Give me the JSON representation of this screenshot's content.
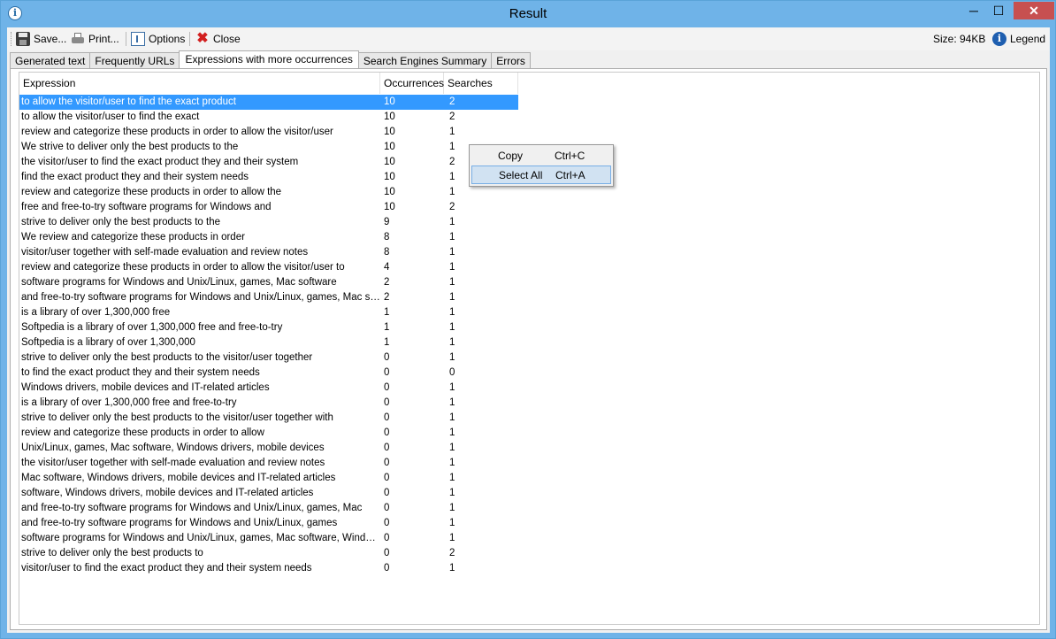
{
  "window": {
    "title": "Result",
    "minimize": "─",
    "maximize": "☐",
    "close": "✕"
  },
  "toolbar": {
    "save_label": "Save...",
    "print_label": "Print...",
    "options_label": "Options",
    "close_label": "Close",
    "size_label": "Size: 94KB",
    "legend_label": "Legend"
  },
  "tabs": [
    {
      "label": "Generated text",
      "active": false
    },
    {
      "label": "Frequently URLs",
      "active": false
    },
    {
      "label": "Expressions with more occurrences",
      "active": true
    },
    {
      "label": "Search Engines Summary",
      "active": false
    },
    {
      "label": "Errors",
      "active": false
    }
  ],
  "table": {
    "headers": [
      "Expression",
      "Occurrences",
      "Searches"
    ],
    "selected_row": 0,
    "rows": [
      [
        "to allow the visitor/user to find the exact product",
        "10",
        "2"
      ],
      [
        "to allow the visitor/user to find the exact",
        "10",
        "2"
      ],
      [
        "review and categorize these products in order to allow the visitor/user",
        "10",
        "1"
      ],
      [
        "We strive to deliver only the best products to the",
        "10",
        "1"
      ],
      [
        "the visitor/user to find the exact product they and their system",
        "10",
        "2"
      ],
      [
        "find the exact product they and their system needs",
        "10",
        "1"
      ],
      [
        "review and categorize these products in order to allow the",
        "10",
        "1"
      ],
      [
        "free and free-to-try software programs for Windows and",
        "10",
        "2"
      ],
      [
        "strive to deliver only the best products to the",
        "9",
        "1"
      ],
      [
        "We review and categorize these products in order",
        "8",
        "1"
      ],
      [
        "visitor/user together with self-made evaluation and review notes",
        "8",
        "1"
      ],
      [
        "review and categorize these products in order to allow the visitor/user to",
        "4",
        "1"
      ],
      [
        "software programs for Windows and Unix/Linux, games, Mac software",
        "2",
        "1"
      ],
      [
        "and free-to-try software programs for Windows and Unix/Linux, games, Mac software",
        "2",
        "1"
      ],
      [
        "is a library of over 1,300,000 free",
        "1",
        "1"
      ],
      [
        "Softpedia is a library of over 1,300,000 free and free-to-try",
        "1",
        "1"
      ],
      [
        "Softpedia is a library of over 1,300,000",
        "1",
        "1"
      ],
      [
        "strive to deliver only the best products to the visitor/user together",
        "0",
        "1"
      ],
      [
        "to find the exact product they and their system needs",
        "0",
        "0"
      ],
      [
        "Windows drivers, mobile devices and IT-related articles",
        "0",
        "1"
      ],
      [
        "is a library of over 1,300,000 free and free-to-try",
        "0",
        "1"
      ],
      [
        "strive to deliver only the best products to the visitor/user together with",
        "0",
        "1"
      ],
      [
        "review and categorize these products in order to allow",
        "0",
        "1"
      ],
      [
        "Unix/Linux, games, Mac software, Windows drivers, mobile devices",
        "0",
        "1"
      ],
      [
        "the visitor/user together with self-made evaluation and review notes",
        "0",
        "1"
      ],
      [
        "Mac software, Windows drivers, mobile devices and IT-related articles",
        "0",
        "1"
      ],
      [
        "software, Windows drivers, mobile devices and IT-related articles",
        "0",
        "1"
      ],
      [
        "and free-to-try software programs for Windows and Unix/Linux, games, Mac",
        "0",
        "1"
      ],
      [
        "and free-to-try software programs for Windows and Unix/Linux, games",
        "0",
        "1"
      ],
      [
        "software programs for Windows and Unix/Linux, games, Mac software, Windows dri...",
        "0",
        "1"
      ],
      [
        "strive to deliver only the best products to",
        "0",
        "2"
      ],
      [
        "visitor/user to find the exact product they and their system needs",
        "0",
        "1"
      ]
    ]
  },
  "context_menu": {
    "items": [
      {
        "label": "Copy",
        "shortcut": "Ctrl+C"
      },
      {
        "label": "Select All",
        "shortcut": "Ctrl+A"
      }
    ]
  },
  "colors": {
    "titlebar": "#6fb3e8",
    "selection": "#3399ff",
    "close_button": "#c75050"
  }
}
